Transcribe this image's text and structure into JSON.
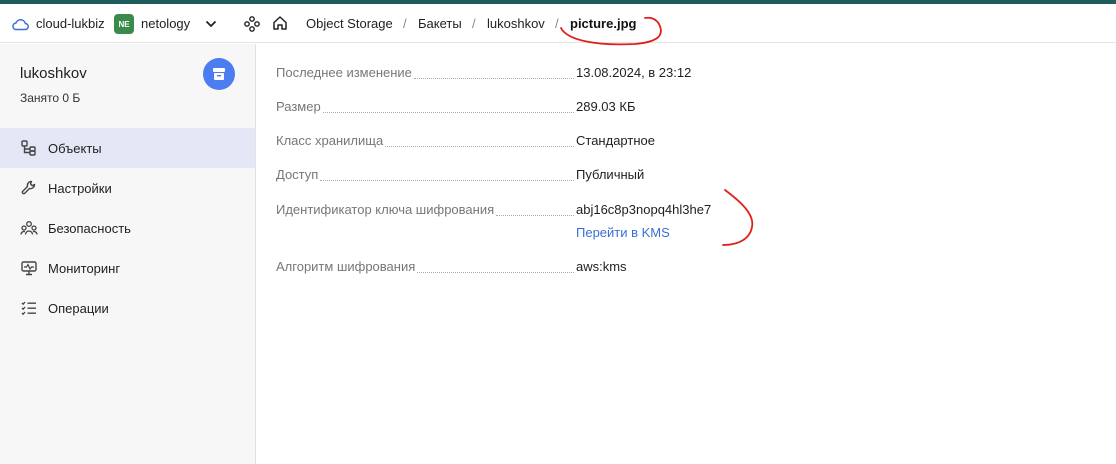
{
  "header": {
    "cloud_name": "cloud-lukbiz",
    "org_badge": "NE",
    "org_name": "netology",
    "breadcrumbs": [
      {
        "label": "Object Storage"
      },
      {
        "label": "Бакеты"
      },
      {
        "label": "lukoshkov"
      },
      {
        "label": "picture.jpg"
      }
    ],
    "separator": "/"
  },
  "sidebar": {
    "bucket_name": "lukoshkov",
    "bucket_usage": "Занято 0 Б",
    "items": [
      {
        "label": "Объекты",
        "icon": "objects-icon",
        "active": true
      },
      {
        "label": "Настройки",
        "icon": "wrench-icon",
        "active": false
      },
      {
        "label": "Безопасность",
        "icon": "users-icon",
        "active": false
      },
      {
        "label": "Мониторинг",
        "icon": "monitor-icon",
        "active": false
      },
      {
        "label": "Операции",
        "icon": "list-icon",
        "active": false
      }
    ]
  },
  "object": {
    "properties": [
      {
        "label": "Последнее изменение",
        "value": "13.08.2024, в 23:12"
      },
      {
        "label": "Размер",
        "value": "289.03 КБ"
      },
      {
        "label": "Класс хранилища",
        "value": "Стандартное"
      },
      {
        "label": "Доступ",
        "value": "Публичный"
      },
      {
        "label": "Идентификатор ключа шифрования",
        "value": "abj16c8p3nopq4hl3he7",
        "link": "Перейти в KMS"
      },
      {
        "label": "Алгоритм шифрования",
        "value": "aws:kms"
      }
    ]
  },
  "colors": {
    "accent": "#4b7df0",
    "link": "#3b6ed8",
    "active_nav": "#e3e7f6",
    "top_line": "#1e5d5b",
    "org_badge": "#3a8a4a",
    "annotation": "#e0201b"
  }
}
